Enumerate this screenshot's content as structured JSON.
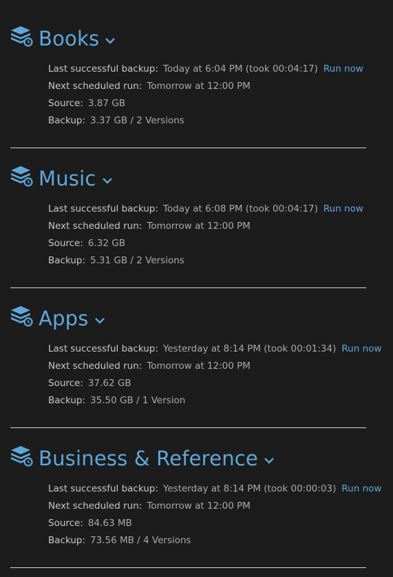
{
  "colors": {
    "background": "#1c1c1c",
    "accent": "#5ea8db",
    "label": "#c8c8c8",
    "value": "#a9a9a9",
    "divider": "#d8d8d8"
  },
  "labels": {
    "last_backup": "Last successful backup:",
    "next_run": "Next scheduled run:",
    "source": "Source:",
    "backup": "Backup:",
    "run_now": "Run now"
  },
  "backup_sets": [
    {
      "name": "Books",
      "icon": "backup-set-icon",
      "last_backup": "Today at 6:04 PM (took 00:04:17)",
      "next_run": "Tomorrow at 12:00 PM",
      "source": "3.87 GB",
      "backup": "3.37 GB / 2 Versions"
    },
    {
      "name": "Music",
      "icon": "backup-set-icon",
      "last_backup": "Today at 6:08 PM (took 00:04:17)",
      "next_run": "Tomorrow at 12:00 PM",
      "source": "6.32 GB",
      "backup": "5.31 GB / 2 Versions"
    },
    {
      "name": "Apps",
      "icon": "backup-set-icon",
      "last_backup": "Yesterday at 8:14 PM (took 00:01:34)",
      "next_run": "Tomorrow at 12:00 PM",
      "source": "37.62 GB",
      "backup": "35.50 GB / 1 Version"
    },
    {
      "name": "Business & Reference",
      "icon": "backup-set-icon",
      "last_backup": "Yesterday at 8:14 PM (took 00:00:03)",
      "next_run": "Tomorrow at 12:00 PM",
      "source": "84.63 MB",
      "backup": "73.56 MB / 4 Versions"
    }
  ]
}
